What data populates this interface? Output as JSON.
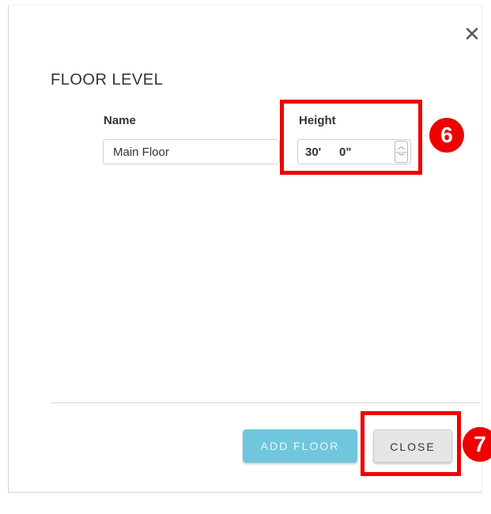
{
  "dialog": {
    "title": "FLOOR LEVEL",
    "close_glyph": "✕",
    "close_icon": "close-icon"
  },
  "fields": {
    "name_label": "Name",
    "name_value": "Main Floor",
    "height_label": "Height",
    "height_feet": "30'",
    "height_inches": "0\"",
    "stepper_up_glyph": "︿",
    "stepper_down_glyph": "﹀"
  },
  "footer": {
    "add_floor_label": "ADD FLOOR",
    "close_label": "CLOSE"
  },
  "annotations": {
    "step_height": "6",
    "step_close": "7"
  },
  "colors": {
    "annotation_red": "#ee0000",
    "add_button": "#6fc6dd",
    "close_button": "#e6e6e6"
  }
}
